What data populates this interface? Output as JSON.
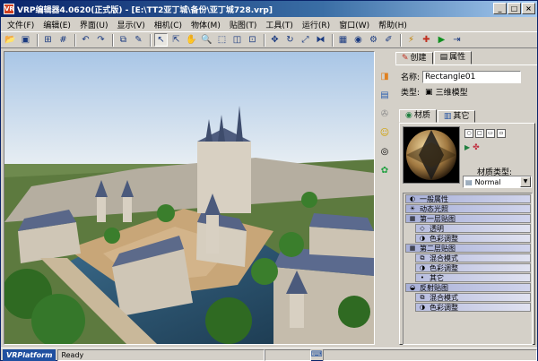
{
  "window": {
    "title": "VRP编辑器4.0620(正式版) - [E:\\TT2亚丁城\\备份\\亚丁城728.vrp]",
    "app_icon_label": "VR",
    "minimize": "_",
    "maximize": "□",
    "close": "×"
  },
  "menubar": {
    "items": [
      "文件(F)",
      "编辑(E)",
      "界面(U)",
      "显示(V)",
      "相机(C)",
      "物体(M)",
      "贴图(T)",
      "工具(T)",
      "运行(R)",
      "窗口(W)",
      "帮助(H)"
    ]
  },
  "toolbar": {
    "icons": [
      "open-icon",
      "save-icon",
      "grid-icon",
      "hash-icon",
      "undo-icon",
      "redo-icon",
      "copy-icon",
      "rename-icon",
      "select-icon",
      "select-add-icon",
      "pan-icon",
      "zoom-icon",
      "zoom-region-icon",
      "fit-icon",
      "fit-all-icon",
      "move-icon",
      "rotate-icon",
      "scale-icon",
      "mirror-icon",
      "material-icon",
      "camera-icon",
      "settings-icon",
      "edit-icon",
      "run-icon",
      "build-icon",
      "play-icon",
      "export-icon"
    ]
  },
  "properties": {
    "tabs": {
      "create": "创建",
      "properties": "属性"
    },
    "name_label": "名称:",
    "name_value": "Rectangle01",
    "type_label": "类型:",
    "type_value": "三维模型",
    "material_tabs": {
      "material": "材质",
      "other": "其它"
    },
    "material_type_label": "材质类型:",
    "material_type_value": "Normal",
    "list": [
      {
        "label": "一般属性",
        "level": 1
      },
      {
        "label": "动态光照",
        "level": 1
      },
      {
        "label": "第一层贴图",
        "level": 1
      },
      {
        "label": "透明",
        "level": 2
      },
      {
        "label": "色彩调整",
        "level": 2
      },
      {
        "label": "第二层贴图",
        "level": 1
      },
      {
        "label": "混合模式",
        "level": 2
      },
      {
        "label": "色彩调整",
        "level": 2
      },
      {
        "label": "其它",
        "level": 2
      },
      {
        "label": "反射贴图",
        "level": 1
      },
      {
        "label": "混合模式",
        "level": 2
      },
      {
        "label": "色彩调整",
        "level": 2
      }
    ]
  },
  "statusbar": {
    "brand": "VRPlatform",
    "status": "Ready"
  },
  "colors": {
    "title_gradient_start": "#0a246a",
    "title_gradient_end": "#a6caf0",
    "face": "#d4d0c8",
    "list_header": "#a8b0d8"
  }
}
